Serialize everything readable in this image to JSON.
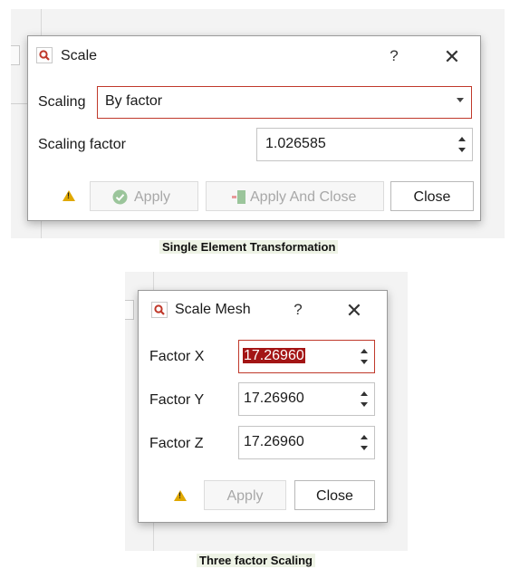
{
  "top_dialog": {
    "title": "Scale",
    "help": "?",
    "close": "✕",
    "scaling_label": "Scaling",
    "scaling_value": "By factor",
    "factor_label": "Scaling factor",
    "factor_value": "1.026585",
    "apply_label": "Apply",
    "apply_close_label": "Apply And Close",
    "close_label": "Close"
  },
  "top_caption": "Single Element Transformation",
  "bottom_dialog": {
    "title": "Scale Mesh",
    "help": "?",
    "close": "✕",
    "factor_x_label": "Factor X",
    "factor_x_value": "17.26960",
    "factor_y_label": "Factor Y",
    "factor_y_value": "17.26960",
    "factor_z_label": "Factor Z",
    "factor_z_value": "17.26960",
    "apply_label": "Apply",
    "close_label": "Close"
  },
  "bottom_caption": "Three factor Scaling",
  "colors": {
    "accent_red": "#c0392b",
    "selection": "#a31515",
    "warning": "#e0a800",
    "apply_icon_green": "#9bc59b"
  },
  "icons": {
    "title": "magnifier-icon",
    "warning": "warning-icon",
    "apply": "check-circle-icon",
    "apply_close": "apply-and-close-icon",
    "dropdown": "chevron-down-icon",
    "spinner": "spinner-arrows-icon"
  }
}
